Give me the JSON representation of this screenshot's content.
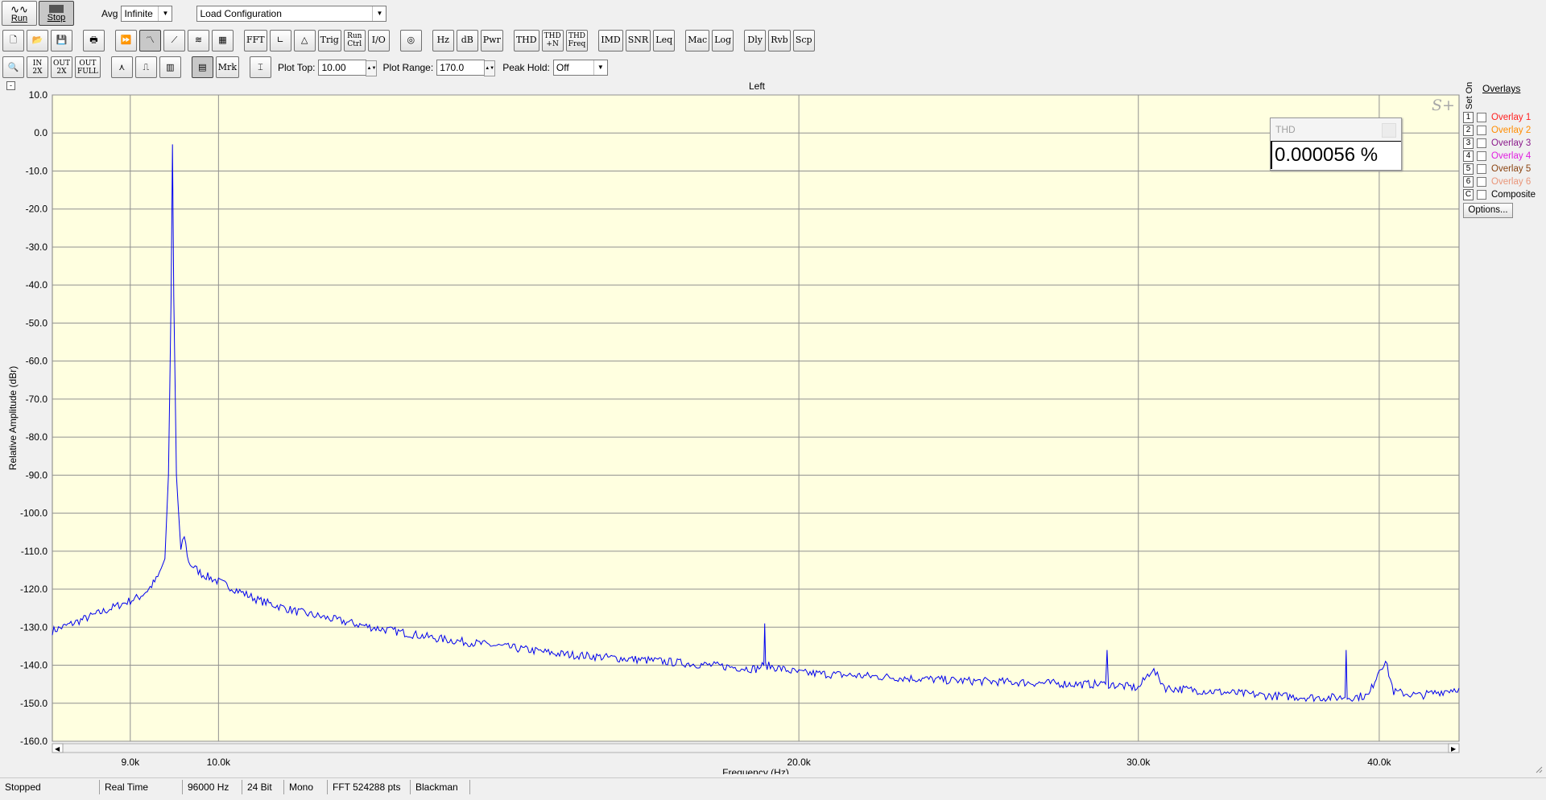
{
  "toolbar1": {
    "run_label": "Run",
    "stop_label": "Stop",
    "avg_label": "Avg",
    "avg_value": "Infinite",
    "config_value": "Load Configuration"
  },
  "toolbar2": {
    "buttons": [
      "FFT",
      "Trig",
      "Run\nCtrl",
      "I/O",
      "Hz",
      "dB",
      "Pwr",
      "THD",
      "THD\n+N",
      "THD\nFreq",
      "IMD",
      "SNR",
      "Leq",
      "Mac",
      "Log",
      "Dly",
      "Rvb",
      "Scp"
    ]
  },
  "toolbar3": {
    "zoom_labels": [
      "IN\n2X",
      "OUT\n2X",
      "OUT\nFULL"
    ],
    "mrk_label": "Mrk",
    "plot_top_label": "Plot Top:",
    "plot_top_value": "10.00",
    "plot_range_label": "Plot Range:",
    "plot_range_value": "170.0",
    "peak_hold_label": "Peak Hold:",
    "peak_hold_value": "Off"
  },
  "graph": {
    "channel_title": "Left",
    "collapse_glyph": "-",
    "watermark": "S+"
  },
  "thd_panel": {
    "title": "THD",
    "value": "0.000056 %"
  },
  "overlays": {
    "title": "Overlays",
    "set_on_label": "Set On",
    "items": [
      {
        "num": "1",
        "label": "Overlay 1",
        "color": "#ff2020"
      },
      {
        "num": "2",
        "label": "Overlay 2",
        "color": "#ff8c00"
      },
      {
        "num": "3",
        "label": "Overlay 3",
        "color": "#8b1a8b"
      },
      {
        "num": "4",
        "label": "Overlay 4",
        "color": "#e020e0"
      },
      {
        "num": "5",
        "label": "Overlay 5",
        "color": "#8b4513"
      },
      {
        "num": "6",
        "label": "Overlay 6",
        "color": "#e9967a"
      },
      {
        "num": "C",
        "label": "Composite",
        "color": "#000000"
      }
    ],
    "options_label": "Options..."
  },
  "status_bar": {
    "state": "Stopped",
    "mode": "Real Time",
    "sample_rate": "96000 Hz",
    "bit_depth": "24 Bit",
    "channels": "Mono",
    "fft_size": "FFT 524288 pts",
    "window": "Blackman"
  },
  "chart_data": {
    "type": "line",
    "title": "Left",
    "xlabel": "Frequency (Hz)",
    "ylabel": "Relative Amplitude (dBr)",
    "x_scale": "log",
    "xlim": [
      8200,
      44000
    ],
    "ylim": [
      -160,
      10
    ],
    "x_ticks": [
      9000,
      10000,
      20000,
      30000,
      40000
    ],
    "x_tick_labels": [
      "9.0k",
      "10.0k",
      "20.0k",
      "30.0k",
      "40.0k"
    ],
    "y_ticks": [
      10,
      0,
      -10,
      -20,
      -30,
      -40,
      -50,
      -60,
      -70,
      -80,
      -90,
      -100,
      -110,
      -120,
      -130,
      -140,
      -150,
      -160
    ],
    "y_tick_labels": [
      "10.0",
      "0.0",
      "-10.0",
      "-20.0",
      "-30.0",
      "-40.0",
      "-50.0",
      "-60.0",
      "-70.0",
      "-80.0",
      "-90.0",
      "-100.0",
      "-110.0",
      "-120.0",
      "-130.0",
      "-140.0",
      "-150.0",
      "-160.0"
    ],
    "grid": true,
    "line_color": "#0000ee",
    "background": "#ffffe0",
    "series": [
      {
        "values": [
          [
            8200,
            -131
          ],
          [
            8400,
            -129
          ],
          [
            8600,
            -127
          ],
          [
            8800,
            -125
          ],
          [
            9000,
            -123
          ],
          [
            9100,
            -122
          ],
          [
            9200,
            -120
          ],
          [
            9300,
            -117
          ],
          [
            9380,
            -112
          ],
          [
            9420,
            -90
          ],
          [
            9450,
            -43
          ],
          [
            9465,
            -3
          ],
          [
            9480,
            -43
          ],
          [
            9510,
            -90
          ],
          [
            9560,
            -110
          ],
          [
            9600,
            -106
          ],
          [
            9650,
            -113
          ],
          [
            9800,
            -116
          ],
          [
            10000,
            -118
          ],
          [
            10500,
            -123
          ],
          [
            11000,
            -126
          ],
          [
            12000,
            -130
          ],
          [
            13000,
            -133
          ],
          [
            14000,
            -135
          ],
          [
            15000,
            -137
          ],
          [
            17000,
            -139
          ],
          [
            19000,
            -141
          ],
          [
            19180,
            -140
          ],
          [
            19200,
            -129
          ],
          [
            19220,
            -140
          ],
          [
            20000,
            -142
          ],
          [
            22000,
            -143
          ],
          [
            24000,
            -144
          ],
          [
            26000,
            -144.5
          ],
          [
            28000,
            -145
          ],
          [
            28850,
            -145
          ],
          [
            28900,
            -136
          ],
          [
            28950,
            -145
          ],
          [
            30000,
            -146
          ],
          [
            30500,
            -141
          ],
          [
            31000,
            -146
          ],
          [
            33000,
            -147
          ],
          [
            35000,
            -148
          ],
          [
            37000,
            -148.5
          ],
          [
            38400,
            -148.5
          ],
          [
            38450,
            -136
          ],
          [
            38500,
            -148.5
          ],
          [
            39500,
            -148
          ],
          [
            40000,
            -141
          ],
          [
            40300,
            -139
          ],
          [
            40700,
            -147
          ],
          [
            42000,
            -148
          ],
          [
            43000,
            -147
          ],
          [
            44000,
            -146
          ]
        ]
      }
    ]
  }
}
